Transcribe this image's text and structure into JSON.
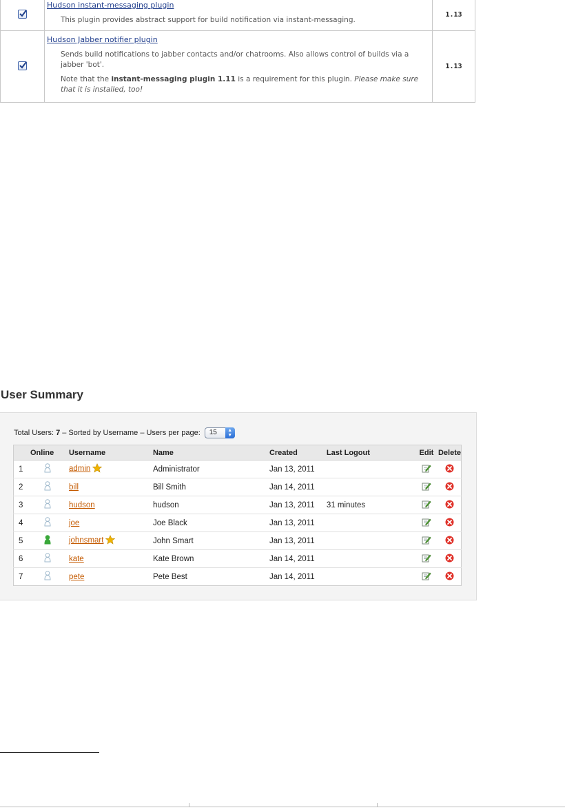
{
  "plugins": [
    {
      "name": "Hudson instant-messaging plugin",
      "description": "This plugin provides abstract support for build notification via instant-messaging.",
      "version": "1.13",
      "checked": true
    },
    {
      "name": "Hudson Jabber notifier plugin",
      "description": "Sends build notifications to jabber contacts and/or chatrooms. Also allows control of builds via a jabber 'bot'.",
      "note_prefix": "Note that the ",
      "note_bold": "instant-messaging plugin 1.11",
      "note_middle": " is a requirement for this plugin. ",
      "note_italic": "Please make sure that it is installed, too!",
      "version": "1.13",
      "checked": true
    }
  ],
  "user_summary": {
    "title": "User Summary",
    "total_label": "Total Users:",
    "total_value": "7",
    "sorted_label": "– Sorted by Username – Users per page:",
    "per_page": "15",
    "columns": {
      "num": "",
      "online": "Online",
      "username": "Username",
      "name": "Name",
      "created": "Created",
      "last_logout": "Last Logout",
      "edit": "Edit",
      "delete": "Delete"
    },
    "rows": [
      {
        "num": "1",
        "online": false,
        "username": "admin",
        "admin": true,
        "name": "Administrator",
        "created": "Jan 13, 2011",
        "last_logout": ""
      },
      {
        "num": "2",
        "online": false,
        "username": "bill",
        "admin": false,
        "name": "Bill Smith",
        "created": "Jan 14, 2011",
        "last_logout": ""
      },
      {
        "num": "3",
        "online": false,
        "username": "hudson",
        "admin": false,
        "name": "hudson",
        "created": "Jan 13, 2011",
        "last_logout": "31 minutes"
      },
      {
        "num": "4",
        "online": false,
        "username": "joe",
        "admin": false,
        "name": "Joe Black",
        "created": "Jan 13, 2011",
        "last_logout": ""
      },
      {
        "num": "5",
        "online": true,
        "username": "johnsmart",
        "admin": true,
        "name": "John Smart",
        "created": "Jan 13, 2011",
        "last_logout": ""
      },
      {
        "num": "6",
        "online": false,
        "username": "kate",
        "admin": false,
        "name": "Kate Brown",
        "created": "Jan 14, 2011",
        "last_logout": ""
      },
      {
        "num": "7",
        "online": false,
        "username": "pete",
        "admin": false,
        "name": "Pete Best",
        "created": "Jan 14, 2011",
        "last_logout": ""
      }
    ]
  },
  "colors": {
    "link_blue": "#23408e",
    "user_link": "#c45a00",
    "online_green": "#3aa83a",
    "offline_blue": "#9fb9cc",
    "delete_red": "#e0322a",
    "star_gold": "#f0b400"
  },
  "icons": {
    "checkbox": "checkbox-checked-icon",
    "online": "user-online-icon",
    "offline": "user-offline-icon",
    "admin": "star-icon",
    "edit": "edit-icon",
    "delete": "delete-icon"
  }
}
